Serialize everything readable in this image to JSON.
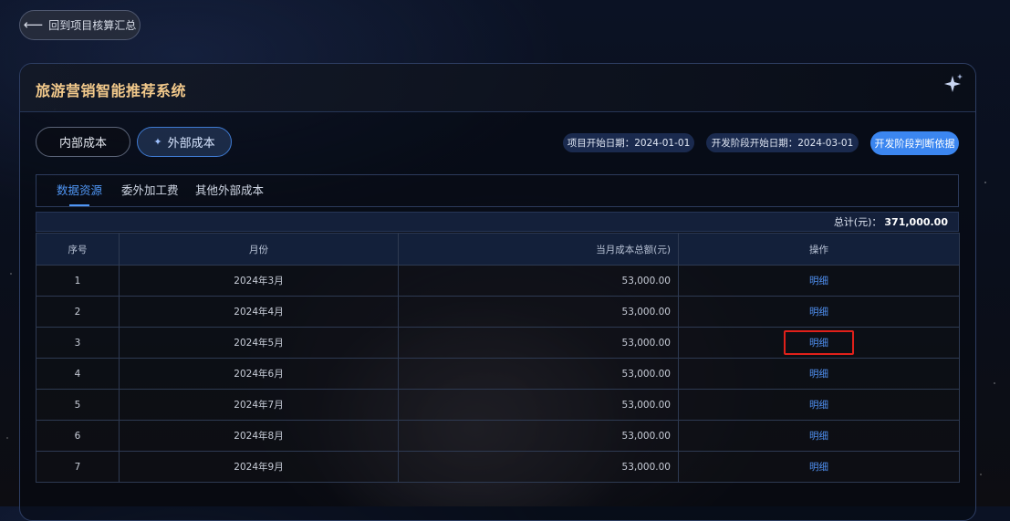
{
  "back_button": {
    "label": "回到项目核算汇总"
  },
  "panel": {
    "title": "旅游营销智能推荐系统"
  },
  "segments": {
    "internal": "内部成本",
    "external": "外部成本"
  },
  "info": {
    "project_start": "项目开始日期：2024-01-01",
    "dev_start": "开发阶段开始日期：2024-03-01",
    "basis_button": "开发阶段判断依据"
  },
  "tabs": [
    {
      "label": "数据资源",
      "active": true
    },
    {
      "label": "委外加工费",
      "active": false
    },
    {
      "label": "其他外部成本",
      "active": false
    }
  ],
  "total": {
    "label": "总计(元)：",
    "value": "371,000.00"
  },
  "table": {
    "headers": [
      "序号",
      "月份",
      "当月成本总额(元)",
      "操作"
    ],
    "rows": [
      {
        "idx": "1",
        "month": "2024年3月",
        "amount": "53,000.00",
        "op": "明细"
      },
      {
        "idx": "2",
        "month": "2024年4月",
        "amount": "53,000.00",
        "op": "明细"
      },
      {
        "idx": "3",
        "month": "2024年5月",
        "amount": "53,000.00",
        "op": "明细"
      },
      {
        "idx": "4",
        "month": "2024年6月",
        "amount": "53,000.00",
        "op": "明细"
      },
      {
        "idx": "5",
        "month": "2024年7月",
        "amount": "53,000.00",
        "op": "明细"
      },
      {
        "idx": "6",
        "month": "2024年8月",
        "amount": "53,000.00",
        "op": "明细"
      },
      {
        "idx": "7",
        "month": "2024年9月",
        "amount": "53,000.00",
        "op": "明细"
      }
    ]
  },
  "colors": {
    "accent": "#3b86f0",
    "title": "#f2c98b",
    "highlight_box": "#e0201a"
  }
}
